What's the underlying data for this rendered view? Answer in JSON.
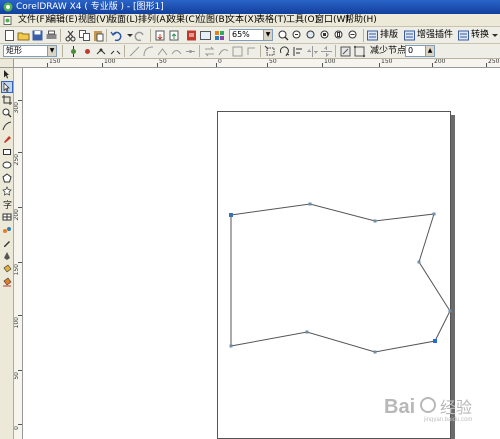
{
  "window": {
    "title": "CorelDRAW X4 ( 专业版 ) - [图形1]"
  },
  "menu": [
    "文件(F)",
    "编辑(E)",
    "视图(V)",
    "版面(L)",
    "排列(A)",
    "效果(C)",
    "位图(B)",
    "文本(X)",
    "表格(T)",
    "工具(O)",
    "窗口(W)",
    "帮助(H)"
  ],
  "toolbar": {
    "zoom_value": "65%",
    "plugin_arrange_label": "排版",
    "plugin_enhance_label": "增强插件",
    "plugin_convert_label": "转换"
  },
  "property_bar": {
    "object_type": "矩形",
    "reduce_nodes_label": "减少节点",
    "reduce_nodes_value": "0"
  },
  "rulers": {
    "horizontal_labels": [
      "150",
      "100",
      "50",
      "0",
      "50",
      "100",
      "150",
      "200",
      "250"
    ],
    "vertical_labels": [
      "300",
      "250",
      "200",
      "150",
      "100",
      "50",
      "0"
    ]
  },
  "toolbox": [
    "pick-tool",
    "shape-tool",
    "crop-tool",
    "zoom-tool",
    "freehand-tool",
    "smart-fill-tool",
    "rectangle-tool",
    "ellipse-tool",
    "polygon-tool",
    "basic-shapes-tool",
    "text-tool",
    "table-tool",
    "interactive-blend-tool",
    "eyedropper-tool",
    "outline-tool",
    "fill-tool",
    "interactive-fill-tool"
  ],
  "watermark": {
    "text": "Bai 经验",
    "sub": "jingyan.baidu.com"
  },
  "colors": {
    "titlebar": "#1c4fb4",
    "chrome": "#ece9d8",
    "shape_outline": "#555555",
    "node": "#3a6fb5"
  }
}
